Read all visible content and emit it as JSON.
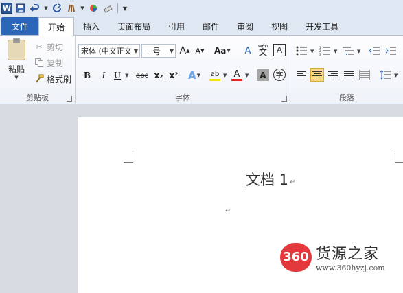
{
  "qat": {
    "app_badge": "W",
    "icons": [
      "save-icon",
      "undo-icon",
      "redo-icon",
      "format-icon",
      "color-icon",
      "eraser-icon",
      "customize-icon"
    ]
  },
  "tabs": [
    {
      "label": "文件"
    },
    {
      "label": "开始"
    },
    {
      "label": "插入"
    },
    {
      "label": "页面布局"
    },
    {
      "label": "引用"
    },
    {
      "label": "邮件"
    },
    {
      "label": "审阅"
    },
    {
      "label": "视图"
    },
    {
      "label": "开发工具"
    }
  ],
  "clipboard": {
    "paste": "粘贴",
    "cut": "剪切",
    "copy": "复制",
    "format_painter": "格式刷",
    "group_label": "剪贴板"
  },
  "font": {
    "font_name": "宋体 (中文正文",
    "font_size": "一号",
    "grow": "A",
    "shrink": "A",
    "case": "Aa",
    "pinyin": "wén",
    "border_char": "A",
    "bold": "B",
    "italic": "I",
    "underline": "U",
    "strike": "abc",
    "subscript": "x₂",
    "superscript": "x²",
    "effects": "A",
    "highlight": "ab",
    "color": "A",
    "shading": "A",
    "enclose": "字",
    "group_label": "字体"
  },
  "paragraph": {
    "group_label": "段落"
  },
  "document": {
    "title": "文档 1",
    "para_mark": "↵"
  },
  "watermark": {
    "badge": "360",
    "name": "货源之家",
    "url": "www.360hyzj.com"
  },
  "colors": {
    "file_tab": "#2a67b8",
    "accent_red": "#e4393c",
    "selected_button": "#f9d889"
  }
}
